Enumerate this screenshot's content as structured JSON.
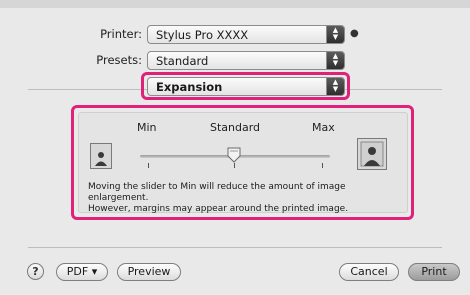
{
  "printer": {
    "label": "Printer:",
    "value": "Stylus Pro XXXX"
  },
  "presets": {
    "label": "Presets:",
    "value": "Standard"
  },
  "panel": {
    "value": "Expansion"
  },
  "expansion": {
    "min_label": "Min",
    "standard_label": "Standard",
    "max_label": "Max",
    "slider_value": "Standard",
    "description_line1": "Moving the slider to Min will reduce the amount of image enlargement.",
    "description_line2": "However, margins may appear around the printed image."
  },
  "footer": {
    "help_label": "?",
    "pdf_label": "PDF ▾",
    "preview_label": "Preview",
    "cancel_label": "Cancel",
    "print_label": "Print"
  },
  "colors": {
    "highlight": "#e0207a"
  }
}
